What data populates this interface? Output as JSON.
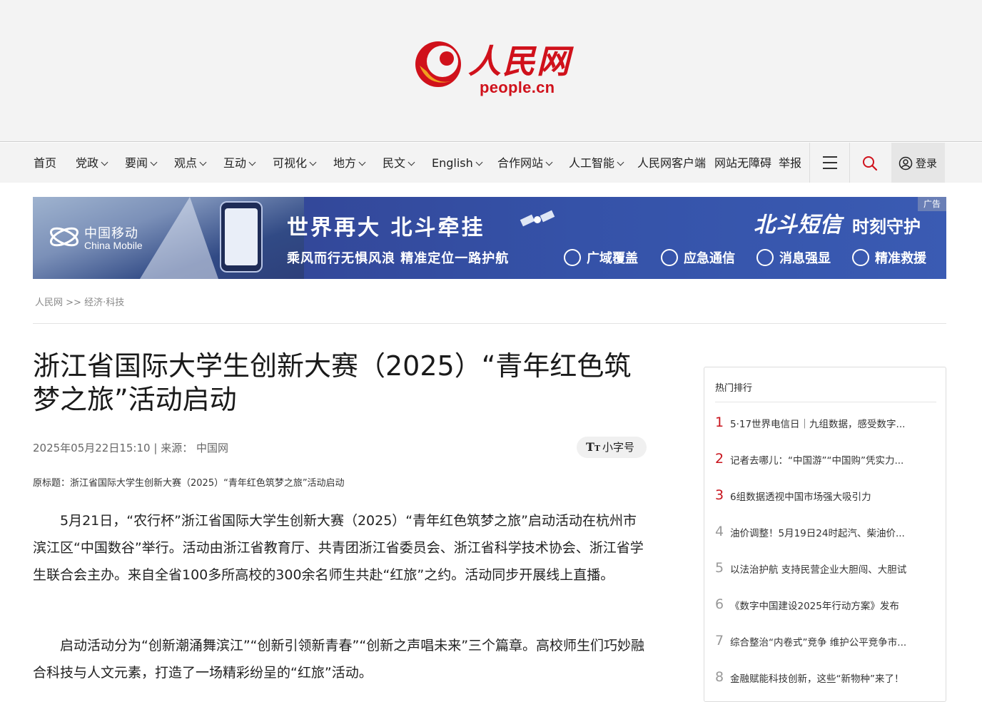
{
  "logo": {
    "name_cn": "人民网",
    "domain": "people.cn"
  },
  "nav": {
    "items": [
      {
        "label": "首页",
        "dropdown": false
      },
      {
        "label": "党政",
        "dropdown": true
      },
      {
        "label": "要闻",
        "dropdown": true
      },
      {
        "label": "观点",
        "dropdown": true
      },
      {
        "label": "互动",
        "dropdown": true
      },
      {
        "label": "可视化",
        "dropdown": true
      },
      {
        "label": "地方",
        "dropdown": true
      },
      {
        "label": "民文",
        "dropdown": true
      },
      {
        "label": "English",
        "dropdown": true
      },
      {
        "label": "合作网站",
        "dropdown": true
      },
      {
        "label": "人工智能",
        "dropdown": true
      },
      {
        "label": "人民网客户端",
        "dropdown": false
      },
      {
        "label": "网站无障碍",
        "dropdown": false
      },
      {
        "label": "举报",
        "dropdown": false
      }
    ],
    "menu_icon": "hamburger-icon",
    "search_icon": "search-icon",
    "login_label": "登录",
    "login_icon": "user-circle-icon"
  },
  "ad": {
    "brand_cn": "中国移动",
    "brand_en": "China Mobile",
    "headline": "世界再大  北斗牵挂",
    "subline": "乘风而行无惧风浪 精准定位一路护航",
    "right_headline": "北斗短信",
    "right_headline2": "时刻守护",
    "features": [
      "广域覆盖",
      "应急通信",
      "消息强显",
      "精准救援"
    ],
    "tag": "广告"
  },
  "breadcrumb": {
    "home": "人民网",
    "sep": ">>",
    "section": "经济·科技"
  },
  "article": {
    "title": "浙江省国际大学生创新大赛（2025）“青年红色筑梦之旅”活动启动",
    "datetime": "2025年05月22日15:10",
    "source_label": "来源：",
    "source": "中国网",
    "font_toggle": "小字号",
    "original_title": "原标题：浙江省国际大学生创新大赛（2025）“青年红色筑梦之旅”活动启动",
    "paragraphs": [
      "5月21日，“农行杯”浙江省国际大学生创新大赛（2025）“青年红色筑梦之旅”启动活动在杭州市滨江区“中国数谷”举行。活动由浙江省教育厅、共青团浙江省委员会、浙江省科学技术协会、浙江省学生联合会主办。来自全省100多所高校的300余名师生共赴“红旅”之约。活动同步开展线上直播。",
      "启动活动分为“创新潮涌舞滨江”“创新引领新青春”“创新之声唱未来”三个篇章。高校师生们巧妙融合科技与人文元素，打造了一场精彩纷呈的“红旅”活动。"
    ]
  },
  "sidebar": {
    "title": "热门排行",
    "items": [
      {
        "rank": "1",
        "text": "5·17世界电信日｜九组数据，感受数字..."
      },
      {
        "rank": "2",
        "text": "记者去哪儿：“中国游”“中国购”凭实力..."
      },
      {
        "rank": "3",
        "text": "6组数据透视中国市场强大吸引力"
      },
      {
        "rank": "4",
        "text": "油价调整！5月19日24时起汽、柴油价..."
      },
      {
        "rank": "5",
        "text": "以法治护航 支持民营企业大胆闯、大胆试"
      },
      {
        "rank": "6",
        "text": "《数字中国建设2025年行动方案》发布"
      },
      {
        "rank": "7",
        "text": "综合整治“内卷式”竞争 维护公平竞争市..."
      },
      {
        "rank": "8",
        "text": "金融赋能科技创新，这些“新物种”来了！"
      }
    ],
    "hot_color": "#c8131c"
  }
}
